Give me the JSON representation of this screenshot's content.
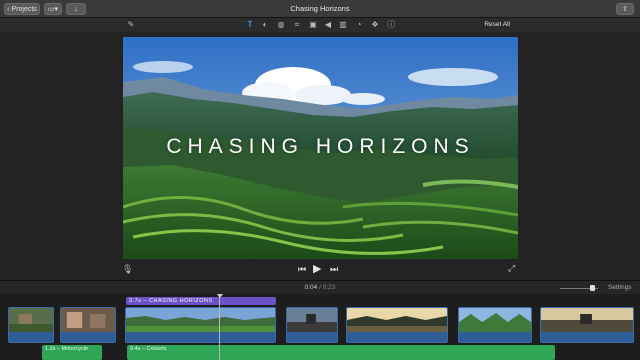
{
  "titlebar": {
    "projects_label": "Projects",
    "window_title": "Chasing Horizons"
  },
  "toolbar": {
    "reset_label": "Reset All",
    "tools": [
      "magic-wand-icon",
      "title-icon",
      "color-balance-icon",
      "color-correction-icon",
      "crop-icon",
      "stabilization-icon",
      "volume-icon",
      "noise-reduction-icon",
      "speed-icon",
      "clip-filter-icon",
      "info-icon"
    ]
  },
  "viewer": {
    "video_title": "CHASING HORIZONS"
  },
  "timecode": {
    "current": "0:04",
    "separator": " / ",
    "total": "0:23"
  },
  "settings_label": "Settings",
  "timeline": {
    "title_clip_label": "3.7s – CHASING HORIZONS",
    "audio_clips": [
      {
        "label": "1.2s – Motorcycle"
      },
      {
        "label": "9.4s – Crickets"
      }
    ]
  },
  "colors": {
    "accent": "#3d9cf0",
    "title_clip": "#6b52c8",
    "video_clip": "#2a4f80",
    "audio_clip": "#2ea655"
  }
}
